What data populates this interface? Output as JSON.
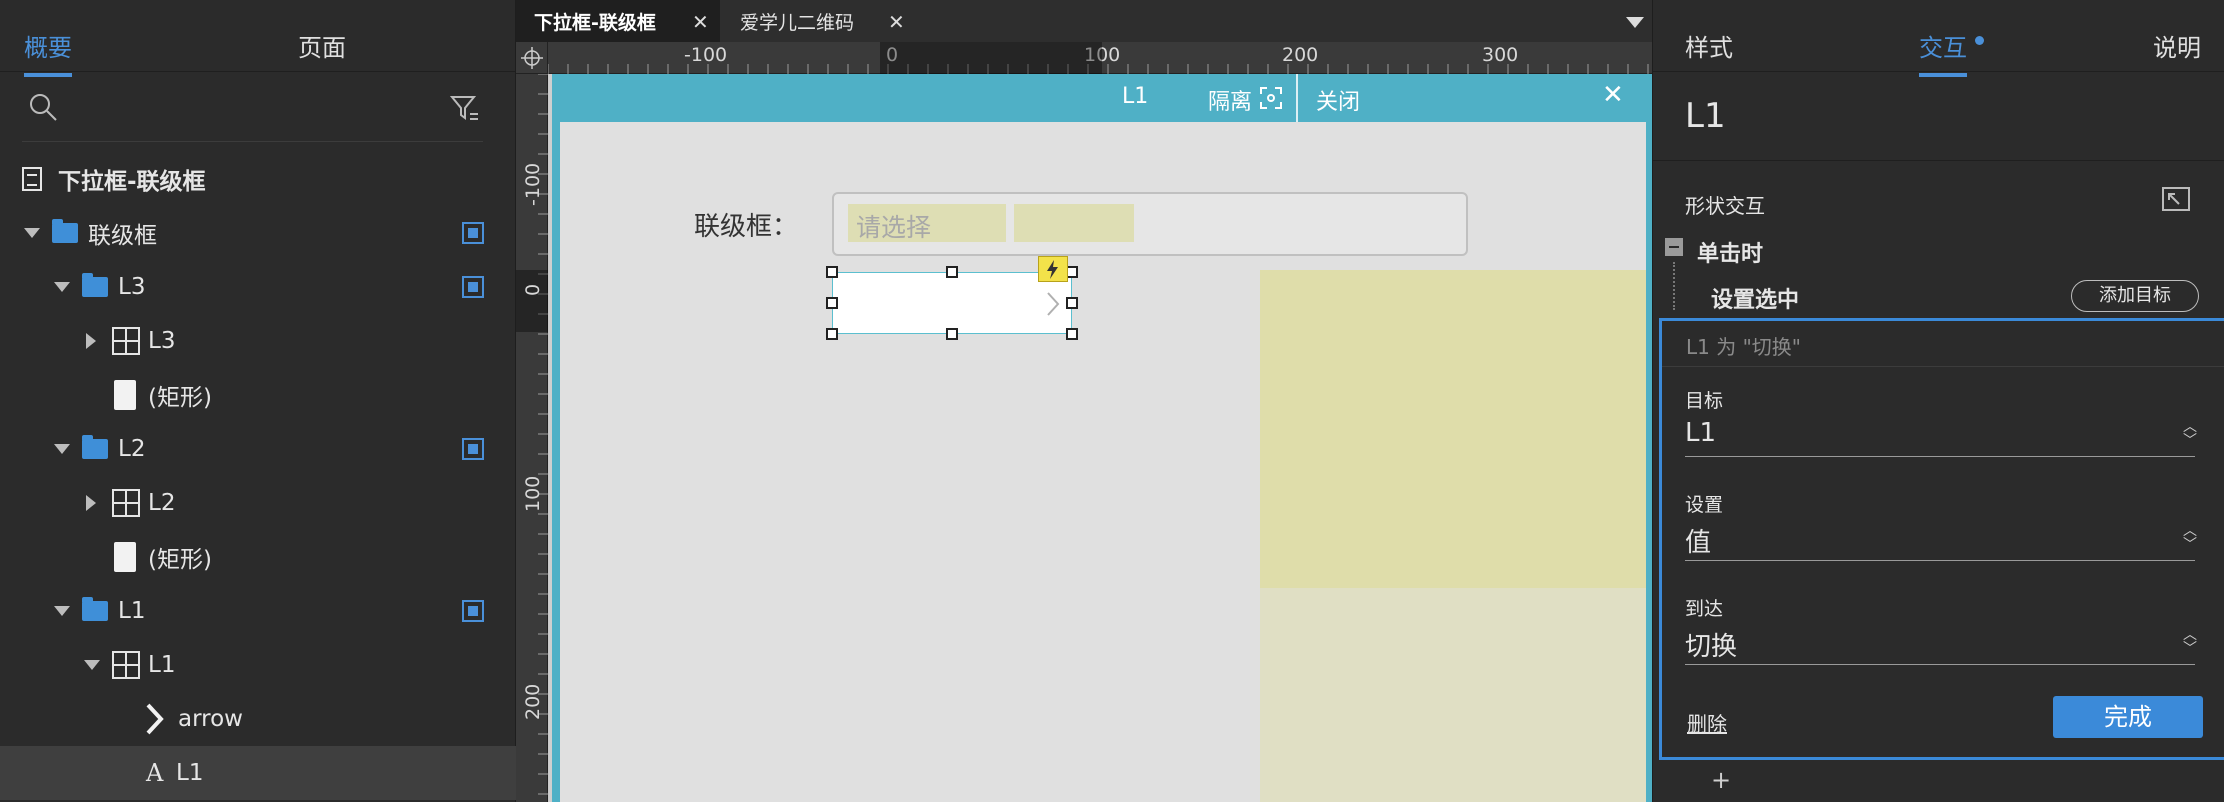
{
  "left_panel": {
    "tabs": [
      {
        "label": "概要"
      },
      {
        "label": "页面"
      }
    ],
    "tree": [
      {
        "label": "下拉框-联级框"
      },
      {
        "label": "联级框"
      },
      {
        "label": "L3"
      },
      {
        "label": "L3"
      },
      {
        "label": "(矩形)"
      },
      {
        "label": "L2"
      },
      {
        "label": "L2"
      },
      {
        "label": "(矩形)"
      },
      {
        "label": "L1"
      },
      {
        "label": "L1"
      },
      {
        "label": "arrow"
      },
      {
        "label": "L1"
      }
    ]
  },
  "editor": {
    "tabs": [
      {
        "label": "下拉框-联级框"
      },
      {
        "label": "爱学儿二维码"
      }
    ],
    "ruler_top": [
      "-100",
      "0",
      "100",
      "200",
      "300"
    ],
    "ruler_left": [
      "-100",
      "0",
      "100",
      "200"
    ],
    "isolation": {
      "title": "L1",
      "isolate_label": "隔离",
      "close_label": "关闭"
    },
    "canvas": {
      "field_label": "联级框：",
      "placeholder": "请选择"
    }
  },
  "right_panel": {
    "tabs": [
      {
        "label": "样式"
      },
      {
        "label": "交互"
      },
      {
        "label": "说明"
      }
    ],
    "element_name": "L1",
    "section_title": "形状交互",
    "event": "单击时",
    "action": "设置选中",
    "add_target": "添加目标",
    "summary": "L1 为 \"切换\"",
    "fields": [
      {
        "label": "目标",
        "value": "L1"
      },
      {
        "label": "设置",
        "value": "值"
      },
      {
        "label": "到达",
        "value": "切换"
      }
    ],
    "delete_label": "删除",
    "done_label": "完成",
    "add_label": "+"
  },
  "colors": {
    "accent": "#4a90d9",
    "isolation": "#4fb0c6",
    "yellow_panel": "#dfddaa"
  }
}
